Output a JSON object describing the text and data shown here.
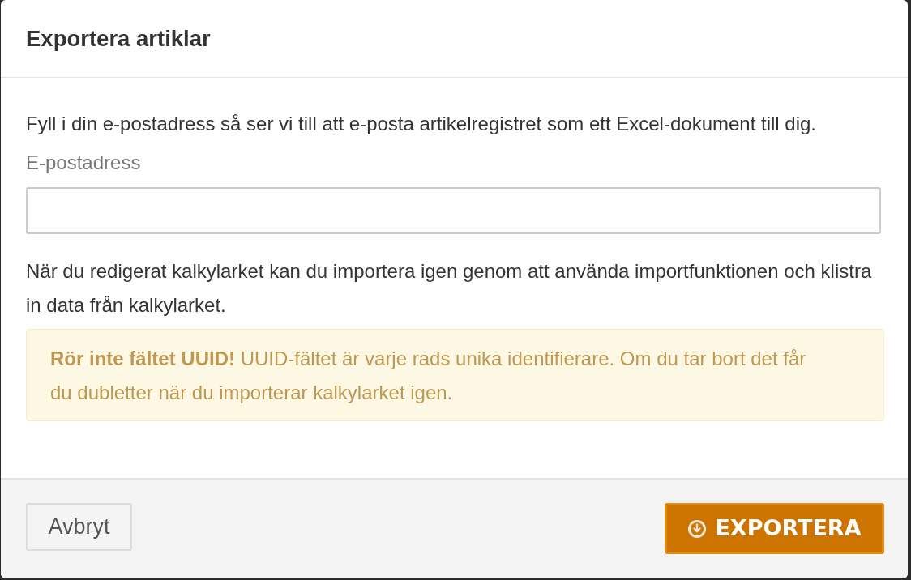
{
  "dialog": {
    "title": "Exportera artiklar"
  },
  "intro": "Fyll i din e-postadress så ser vi till att e-posta artikelregistret som ett Excel-dokument till dig.",
  "email_field": {
    "label": "E-postadress"
  },
  "note": "När du redigerat kalkylarket kan du importera igen genom att använda importfunktionen och klistra in data från kalkylarket.",
  "alert": {
    "text": "**Rör inte fältet UUID!** UUID-fältet är varje rads unika identifierare. Om du tar bort det får du dubletter när du importerar kalkylarket igen."
  },
  "buttons": [
    {
      "label": "Avbryt",
      "kind": "secondary"
    },
    {
      "label": "EXPORTERA",
      "kind": "primary"
    }
  ]
}
